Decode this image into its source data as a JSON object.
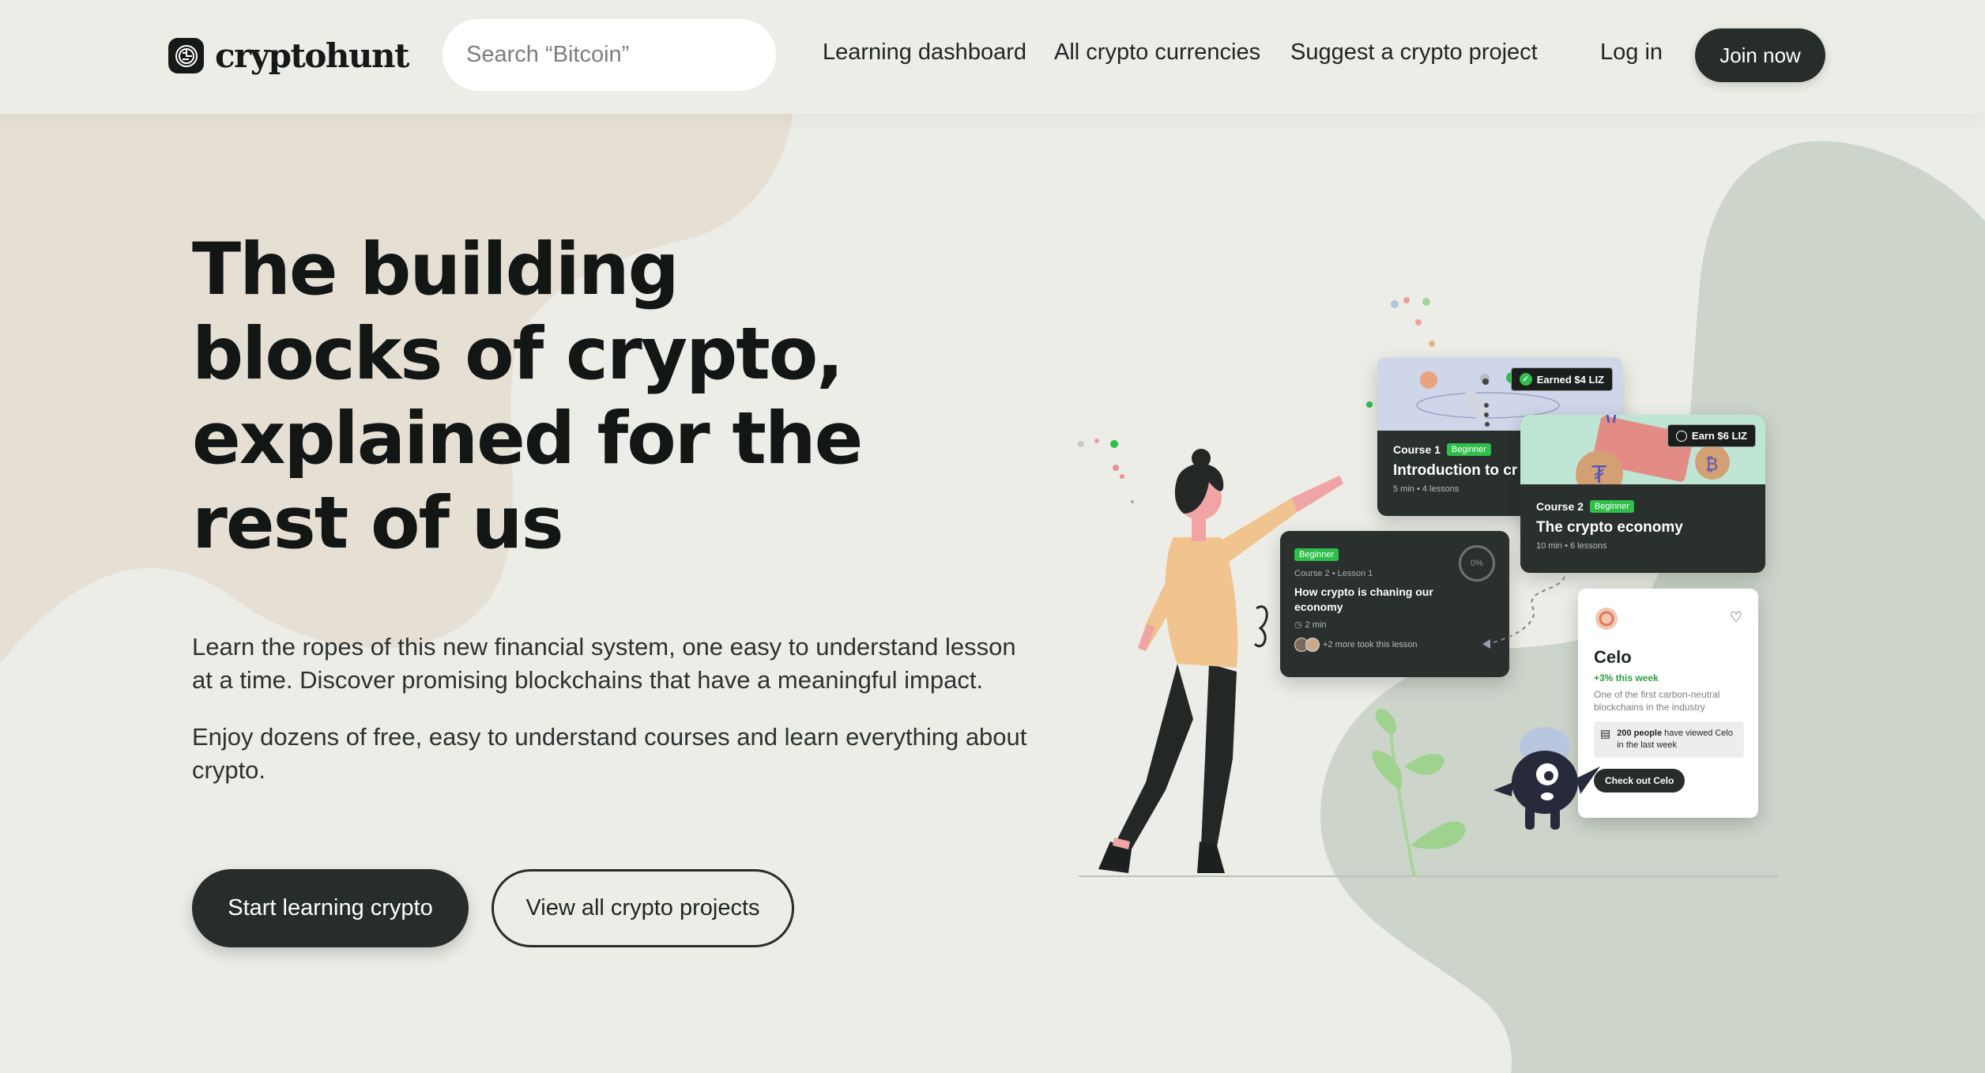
{
  "brand": {
    "name": "cryptohunt"
  },
  "search": {
    "placeholder": "Search “Bitcoin”"
  },
  "nav": {
    "links": [
      "Learning dashboard",
      "All crypto currencies",
      "Suggest a crypto project"
    ],
    "login": "Log in",
    "join": "Join now"
  },
  "hero": {
    "title_lines": [
      "The building",
      "blocks of crypto,",
      "explained for the",
      "rest of us"
    ],
    "paragraph1": "Learn the ropes of this new financial system, one easy to understand lesson at a time. Discover promising blockchains that have a meaningful impact.",
    "paragraph2": "Enjoy dozens of free, easy to understand courses and learn everything about crypto.",
    "cta_primary": "Start learning crypto",
    "cta_secondary": "View all crypto projects"
  },
  "illustration": {
    "course1": {
      "course_label": "Course 1",
      "level": "Beginner",
      "title": "Introduction to cr",
      "meta": "5 min • 4 lessons",
      "earned": "Earned $4 LIZ"
    },
    "course2": {
      "course_label": "Course 2",
      "level": "Beginner",
      "title": "The crypto economy",
      "meta": "10 min • 6 lessons",
      "earn": "Earn $6 LIZ"
    },
    "lesson": {
      "level": "Beginner",
      "meta": "Course 2 • Lesson 1",
      "title": "How crypto is chaning our economy",
      "duration": "2 min",
      "progress": "0%",
      "participants": "+2 more took this lesson"
    },
    "celo": {
      "name": "Celo",
      "change": "+3% this week",
      "description": "One of the first carbon-neutral blockchains in the industry",
      "views_bold": "200 people",
      "views_rest": "have viewed Celo in the last week",
      "button": "Check out Celo"
    }
  },
  "colors": {
    "background": "#ecede7",
    "beige_blob": "#e6e0d4",
    "green_blob": "#cdd5cb",
    "dark": "#272d2a",
    "accent_green": "#2fbf4a"
  }
}
